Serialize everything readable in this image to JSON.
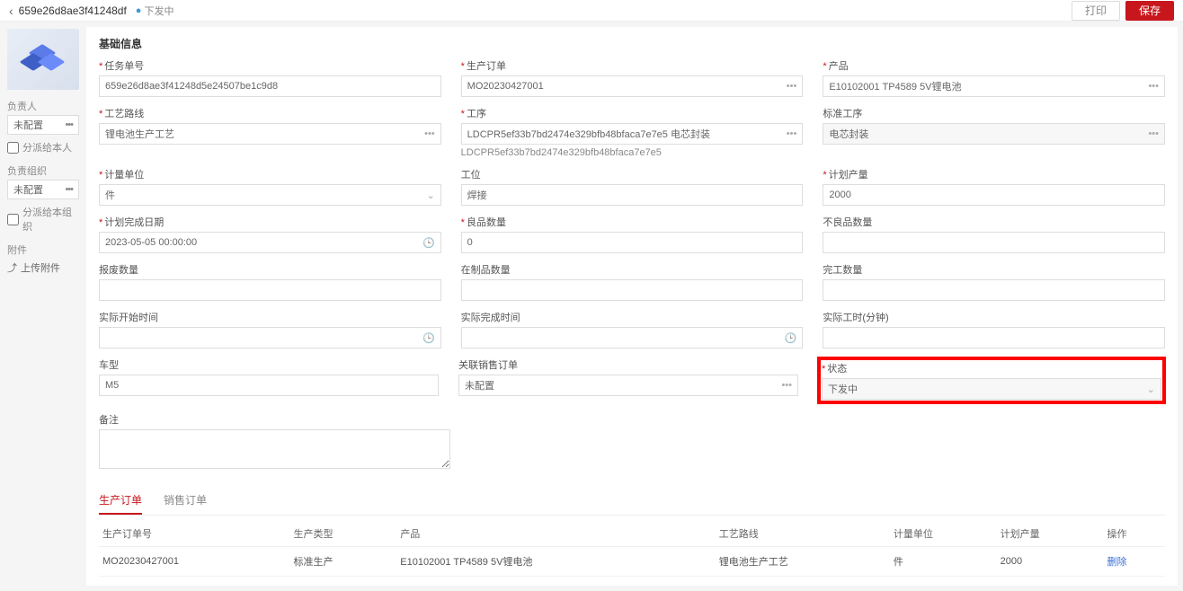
{
  "topbar": {
    "title": "659e26d8ae3f41248df",
    "badge_dot": "●",
    "badge": "下发中",
    "print": "打印",
    "save": "保存"
  },
  "sidebar": {
    "owner_label": "负责人",
    "owner_value": "未配置",
    "dispatch_owner": "分派给本人",
    "org_label": "负责组织",
    "org_value": "未配置",
    "dispatch_org": "分派给本组织",
    "attach_label": "附件",
    "upload": "上传附件"
  },
  "section": {
    "title": "基础信息"
  },
  "f": {
    "task_no": {
      "label": "任务单号",
      "value": "659e26d8ae3f41248d5e24507be1c9d8"
    },
    "prod_order": {
      "label": "生产订单",
      "value": "MO20230427001"
    },
    "product": {
      "label": "产品",
      "value": "E10102001 TP4589 5V锂电池"
    },
    "route": {
      "label": "工艺路线",
      "value": "锂电池生产工艺"
    },
    "proc": {
      "label": "工序",
      "value": "LDCPR5ef33b7bd2474e329bfb48bfaca7e7e5 电芯封装",
      "hint": "LDCPR5ef33b7bd2474e329bfb48bfaca7e7e5"
    },
    "std_proc": {
      "label": "标准工序",
      "value": "电芯封装"
    },
    "unit": {
      "label": "计量单位",
      "value": "件"
    },
    "station": {
      "label": "工位",
      "value": "焊接"
    },
    "plan_qty": {
      "label": "计划产量",
      "value": "2000"
    },
    "plan_end": {
      "label": "计划完成日期",
      "value": "2023-05-05 00:00:00"
    },
    "good_qty": {
      "label": "良品数量",
      "value": "0"
    },
    "bad_qty": {
      "label": "不良品数量",
      "value": ""
    },
    "scrap_qty": {
      "label": "报废数量",
      "value": ""
    },
    "wip_qty": {
      "label": "在制品数量",
      "value": ""
    },
    "done_qty": {
      "label": "完工数量",
      "value": ""
    },
    "real_start": {
      "label": "实际开始时间",
      "value": ""
    },
    "real_end": {
      "label": "实际完成时间",
      "value": ""
    },
    "real_hours": {
      "label": "实际工时(分钟)",
      "value": ""
    },
    "model": {
      "label": "车型",
      "value": "M5"
    },
    "sales_ord": {
      "label": "关联销售订单",
      "value": "未配置"
    },
    "status": {
      "label": "状态",
      "value": "下发中"
    },
    "remark": {
      "label": "备注"
    }
  },
  "tabs": {
    "t1": "生产订单",
    "t2": "销售订单"
  },
  "table": {
    "h": {
      "c1": "生产订单号",
      "c2": "生产类型",
      "c3": "产品",
      "c4": "工艺路线",
      "c5": "计量单位",
      "c6": "计划产量",
      "c7": "操作"
    },
    "r": {
      "c1": "MO20230427001",
      "c2": "标准生产",
      "c3": "E10102001 TP4589 5V锂电池",
      "c4": "锂电池生产工艺",
      "c5": "件",
      "c6": "2000",
      "c7": "删除"
    }
  }
}
